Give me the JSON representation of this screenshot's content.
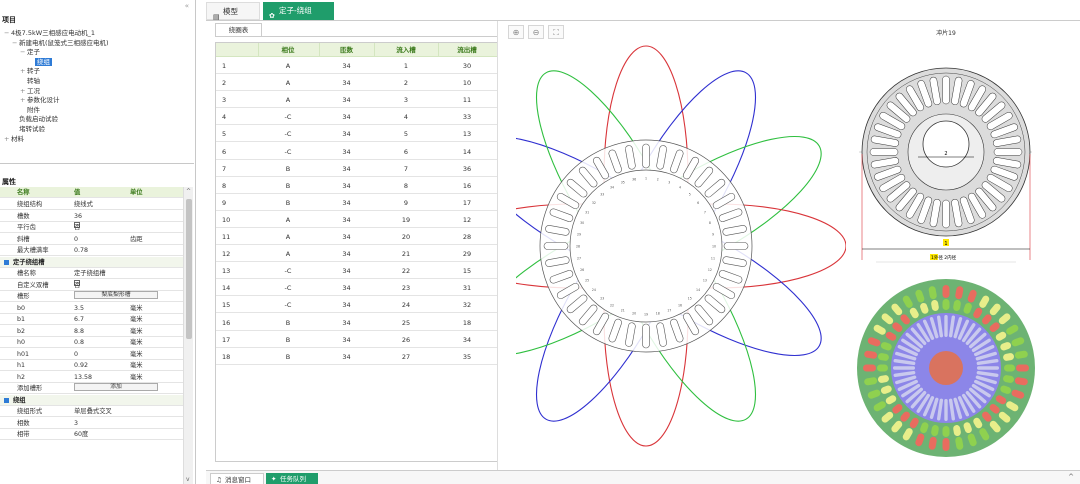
{
  "left": {
    "collapse_icon": "«",
    "project_title": "项目",
    "tree": [
      {
        "label": "4极7.5kW三相感应电动机_1",
        "toggle": "−",
        "indent": 0
      },
      {
        "label": "新建电机(鼠笼式三相感应电机)",
        "toggle": "−",
        "indent": 1
      },
      {
        "label": "定子",
        "toggle": "−",
        "indent": 2
      },
      {
        "label": "绕组",
        "toggle": "",
        "indent": 3,
        "selected": true
      },
      {
        "label": "转子",
        "toggle": "+",
        "indent": 2
      },
      {
        "label": "转轴",
        "toggle": "",
        "indent": 2
      },
      {
        "label": "工况",
        "toggle": "+",
        "indent": 2
      },
      {
        "label": "参数化设计",
        "toggle": "+",
        "indent": 2
      },
      {
        "label": "附件",
        "toggle": "",
        "indent": 2
      },
      {
        "label": "负载启动试验",
        "toggle": "",
        "indent": 1
      },
      {
        "label": "堵转试验",
        "toggle": "",
        "indent": 1
      },
      {
        "label": "材料",
        "toggle": "+",
        "indent": 0
      }
    ],
    "props_title": "属性",
    "props_header": {
      "name": "名称",
      "value": "值",
      "unit": "单位"
    },
    "props": [
      {
        "type": "row",
        "name": "绕组结构",
        "value": "绕线式",
        "unit": ""
      },
      {
        "type": "row",
        "name": "槽数",
        "value": "36",
        "unit": ""
      },
      {
        "type": "check",
        "name": "平行齿",
        "value": "否"
      },
      {
        "type": "row",
        "name": "斜槽",
        "value": "0",
        "unit": "齿距"
      },
      {
        "type": "row",
        "name": "最大槽满率",
        "value": "0.78",
        "unit": ""
      },
      {
        "type": "group",
        "name": "定子绕组槽"
      },
      {
        "type": "row",
        "name": "槽名称",
        "value": "定子绕组槽",
        "unit": ""
      },
      {
        "type": "check",
        "name": "自定义双槽",
        "value": "否"
      },
      {
        "type": "button",
        "name": "槽形",
        "value": "梨底梨形槽"
      },
      {
        "type": "row",
        "name": "b0",
        "value": "3.5",
        "unit": "毫米"
      },
      {
        "type": "row",
        "name": "b1",
        "value": "6.7",
        "unit": "毫米"
      },
      {
        "type": "row",
        "name": "b2",
        "value": "8.8",
        "unit": "毫米"
      },
      {
        "type": "row",
        "name": "h0",
        "value": "0.8",
        "unit": "毫米"
      },
      {
        "type": "row",
        "name": "h01",
        "value": "0",
        "unit": "毫米"
      },
      {
        "type": "row",
        "name": "h1",
        "value": "0.92",
        "unit": "毫米"
      },
      {
        "type": "row",
        "name": "h2",
        "value": "13.58",
        "unit": "毫米"
      },
      {
        "type": "button",
        "name": "添加槽形",
        "value": "添加"
      },
      {
        "type": "group",
        "name": "绕组"
      },
      {
        "type": "row",
        "name": "绕组形式",
        "value": "单层叠式交叉",
        "unit": ""
      },
      {
        "type": "row",
        "name": "相数",
        "value": "3",
        "unit": ""
      },
      {
        "type": "row",
        "name": "相带",
        "value": "60度",
        "unit": ""
      }
    ]
  },
  "tabs": [
    {
      "label": "模型",
      "icon": "cube-icon"
    },
    {
      "label": "定子-绕组",
      "icon": "gear-icon"
    }
  ],
  "subtab": "绕圈表",
  "table": {
    "headers": [
      "",
      "相位",
      "匝数",
      "流入槽",
      "流出槽"
    ],
    "rows": [
      [
        "1",
        "A",
        "34",
        "1",
        "30"
      ],
      [
        "2",
        "A",
        "34",
        "2",
        "10"
      ],
      [
        "3",
        "A",
        "34",
        "3",
        "11"
      ],
      [
        "4",
        "-C",
        "34",
        "4",
        "33"
      ],
      [
        "5",
        "-C",
        "34",
        "5",
        "13"
      ],
      [
        "6",
        "-C",
        "34",
        "6",
        "14"
      ],
      [
        "7",
        "B",
        "34",
        "7",
        "36"
      ],
      [
        "8",
        "B",
        "34",
        "8",
        "16"
      ],
      [
        "9",
        "B",
        "34",
        "9",
        "17"
      ],
      [
        "10",
        "A",
        "34",
        "19",
        "12"
      ],
      [
        "11",
        "A",
        "34",
        "20",
        "28"
      ],
      [
        "12",
        "A",
        "34",
        "21",
        "29"
      ],
      [
        "13",
        "-C",
        "34",
        "22",
        "15"
      ],
      [
        "14",
        "-C",
        "34",
        "23",
        "31"
      ],
      [
        "15",
        "-C",
        "34",
        "24",
        "32"
      ],
      [
        "16",
        "B",
        "34",
        "25",
        "18"
      ],
      [
        "17",
        "B",
        "34",
        "26",
        "34"
      ],
      [
        "18",
        "B",
        "34",
        "27",
        "35"
      ]
    ]
  },
  "zoom_buttons": [
    "⊕",
    "⊖",
    "⛶"
  ],
  "punch": {
    "title": "冲片19",
    "dim_label": "2",
    "badge": "1",
    "caption": "1外径  2内径"
  },
  "colors": {
    "accent": "#1f9d6b",
    "phase_a": "#d9353a",
    "phase_b": "#2f2fd0",
    "phase_c": "#2fbf3f",
    "header_bg": "#eaf3dc"
  },
  "bottom": {
    "tabs": [
      {
        "label": "消息窗口",
        "icon": "bell-icon"
      },
      {
        "label": "任务队列",
        "icon": "tasks-icon"
      }
    ],
    "expand_icon": "^"
  }
}
